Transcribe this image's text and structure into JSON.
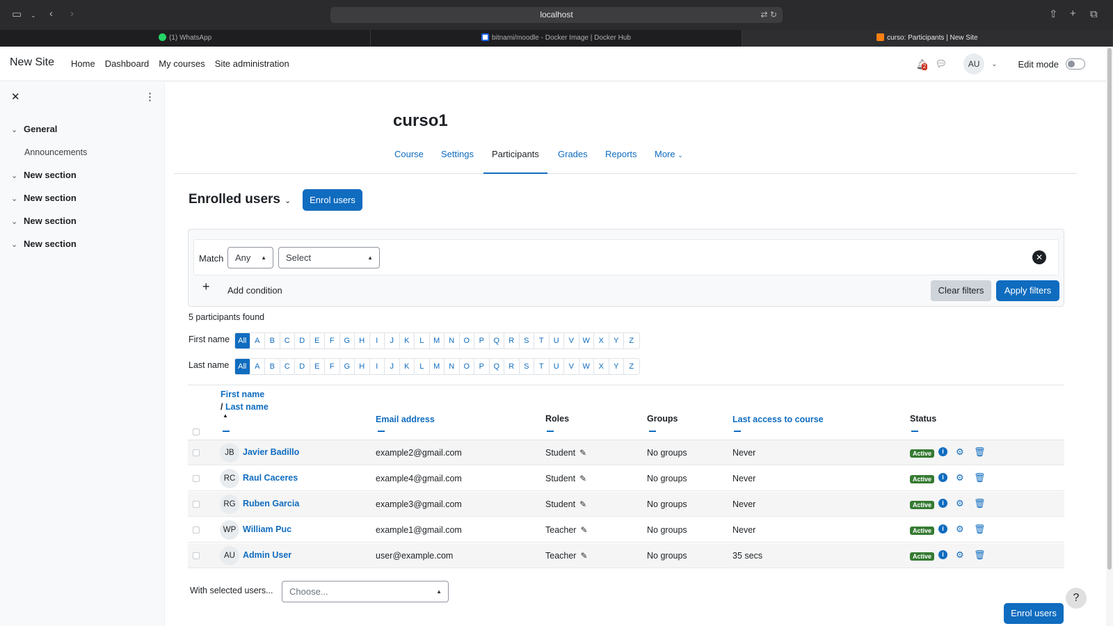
{
  "browser": {
    "url": "localhost",
    "tabs": [
      {
        "title": "(1) WhatsApp",
        "active": false
      },
      {
        "title": "bitnami/moodle - Docker Image | Docker Hub",
        "active": false
      },
      {
        "title": "curso: Participants | New Site",
        "active": true
      }
    ]
  },
  "navbar": {
    "site_name": "New Site",
    "links": [
      "Home",
      "Dashboard",
      "My courses",
      "Site administration"
    ],
    "notification_count": "2",
    "user_initials": "AU",
    "edit_mode_label": "Edit mode",
    "edit_mode_on": false
  },
  "drawer": {
    "sections": [
      {
        "label": "General",
        "children": [
          "Announcements"
        ]
      },
      {
        "label": "New section",
        "children": []
      },
      {
        "label": "New section",
        "children": []
      },
      {
        "label": "New section",
        "children": []
      },
      {
        "label": "New section",
        "children": []
      }
    ]
  },
  "course": {
    "title": "curso1",
    "tabs": [
      "Course",
      "Settings",
      "Participants",
      "Grades",
      "Reports",
      "More"
    ],
    "active_tab": "Participants"
  },
  "participants": {
    "heading": "Enrolled users",
    "enrol_button": "Enrol users",
    "filter": {
      "match_label": "Match",
      "match_value": "Any",
      "condition_placeholder": "Select",
      "add_condition": "Add condition",
      "clear_filters": "Clear filters",
      "apply_filters": "Apply filters"
    },
    "found_text": "5 participants found",
    "first_name_label": "First name",
    "last_name_label": "Last name",
    "letters": [
      "All",
      "A",
      "B",
      "C",
      "D",
      "E",
      "F",
      "G",
      "H",
      "I",
      "J",
      "K",
      "L",
      "M",
      "N",
      "O",
      "P",
      "Q",
      "R",
      "S",
      "T",
      "U",
      "V",
      "W",
      "X",
      "Y",
      "Z"
    ],
    "columns": {
      "first_name": "First name",
      "separator": "/",
      "last_name": "Last name",
      "email": "Email address",
      "roles": "Roles",
      "groups": "Groups",
      "last_access": "Last access to course",
      "status": "Status"
    },
    "rows": [
      {
        "initials": "JB",
        "name": "Javier Badillo",
        "email": "example2@gmail.com",
        "role": "Student",
        "groups": "No groups",
        "last_access": "Never",
        "status": "Active"
      },
      {
        "initials": "RC",
        "name": "Raul Caceres",
        "email": "example4@gmail.com",
        "role": "Student",
        "groups": "No groups",
        "last_access": "Never",
        "status": "Active"
      },
      {
        "initials": "RG",
        "name": "Ruben Garcia",
        "email": "example3@gmail.com",
        "role": "Student",
        "groups": "No groups",
        "last_access": "Never",
        "status": "Active"
      },
      {
        "initials": "WP",
        "name": "William Puc",
        "email": "example1@gmail.com",
        "role": "Teacher",
        "groups": "No groups",
        "last_access": "Never",
        "status": "Active"
      },
      {
        "initials": "AU",
        "name": "Admin User",
        "email": "user@example.com",
        "role": "Teacher",
        "groups": "No groups",
        "last_access": "35 secs",
        "status": "Active"
      }
    ],
    "with_selected_label": "With selected users...",
    "with_selected_placeholder": "Choose...",
    "enrol_button_bottom": "Enrol users"
  },
  "help_label": "?",
  "colors": {
    "primary": "#0f6cbf",
    "active_badge": "#357a32",
    "browser_chrome": "#2b2b2d"
  }
}
